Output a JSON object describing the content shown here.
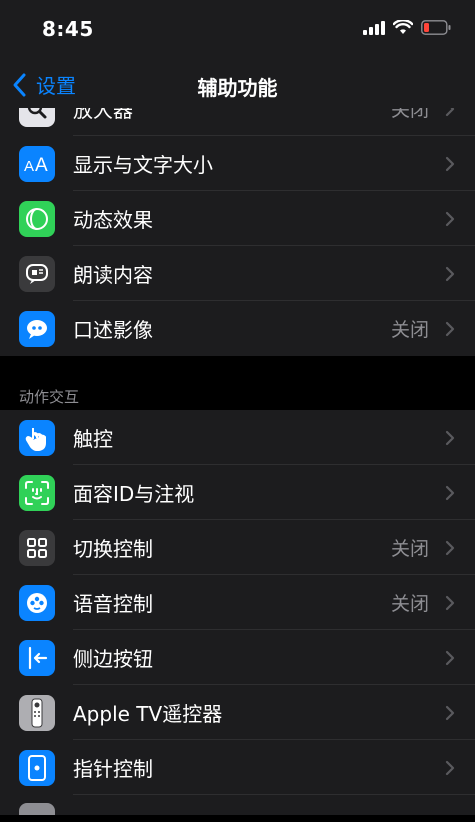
{
  "status_bar": {
    "time": "8:45"
  },
  "nav": {
    "back_label": "设置",
    "title": "辅助功能"
  },
  "vision_items": [
    {
      "label": "放大器",
      "value": "关闭",
      "icon": "magnifier-icon",
      "color": "#2c2c2e"
    },
    {
      "label": "显示与文字大小",
      "value": "",
      "icon": "text-size-icon",
      "color": "#0a84ff"
    },
    {
      "label": "动态效果",
      "value": "",
      "icon": "motion-icon",
      "color": "#30d158"
    },
    {
      "label": "朗读内容",
      "value": "",
      "icon": "speech-icon",
      "color": "#3a3a3c"
    },
    {
      "label": "口述影像",
      "value": "关闭",
      "icon": "audio-description-icon",
      "color": "#0a84ff"
    }
  ],
  "interaction_section": {
    "header": "动作交互",
    "items": [
      {
        "label": "触控",
        "value": "",
        "icon": "touch-icon",
        "color": "#0a84ff"
      },
      {
        "label": "面容ID与注视",
        "value": "",
        "icon": "face-id-icon",
        "color": "#30d158"
      },
      {
        "label": "切换控制",
        "value": "关闭",
        "icon": "switch-control-icon",
        "color": "#3a3a3c"
      },
      {
        "label": "语音控制",
        "value": "关闭",
        "icon": "voice-control-icon",
        "color": "#0a84ff"
      },
      {
        "label": "侧边按钮",
        "value": "",
        "icon": "side-button-icon",
        "color": "#0a84ff"
      },
      {
        "label": "Apple TV遥控器",
        "value": "",
        "icon": "apple-tv-remote-icon",
        "color": "#8e8e93"
      },
      {
        "label": "指针控制",
        "value": "",
        "icon": "pointer-control-icon",
        "color": "#0a84ff"
      }
    ]
  }
}
